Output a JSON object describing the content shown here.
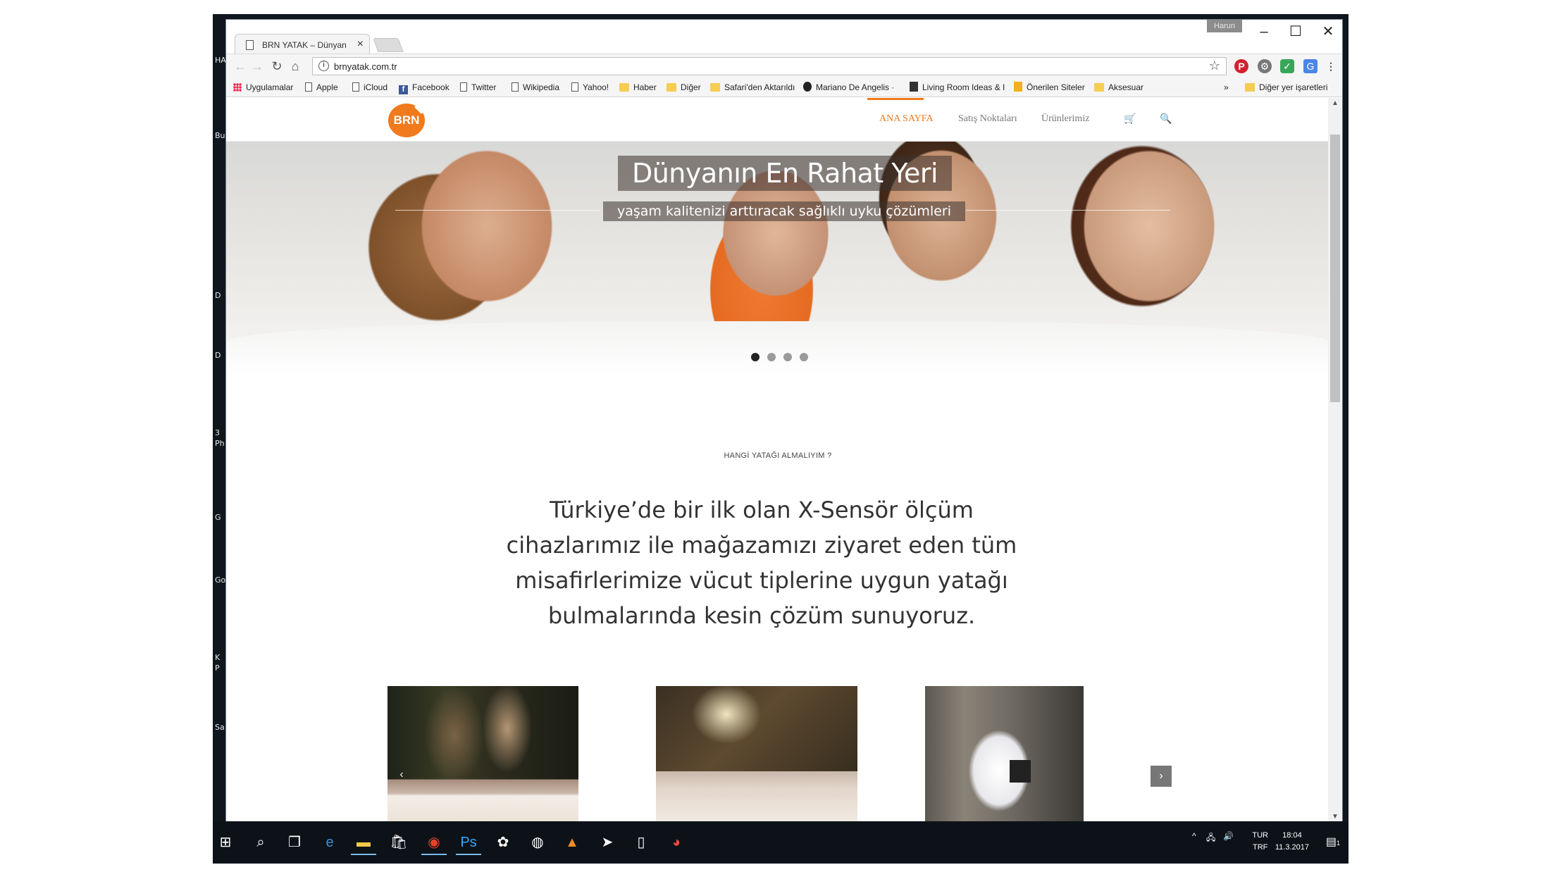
{
  "browser": {
    "tab_title": "BRN YATAK – Dünyanın E",
    "profile_name": "Harun",
    "url": "brnyatak.com.tr"
  },
  "bookmarks": {
    "items": [
      {
        "label": "Uygulamalar",
        "icon": "apps-icon"
      },
      {
        "label": "Apple",
        "icon": "page-icon"
      },
      {
        "label": "iCloud",
        "icon": "page-icon"
      },
      {
        "label": "Facebook",
        "icon": "facebook-icon"
      },
      {
        "label": "Twitter",
        "icon": "page-icon"
      },
      {
        "label": "Wikipedia",
        "icon": "page-icon"
      },
      {
        "label": "Yahoo!",
        "icon": "page-icon"
      },
      {
        "label": "Haber",
        "icon": "folder-icon"
      },
      {
        "label": "Diğer",
        "icon": "folder-icon"
      },
      {
        "label": "Safari'den Aktarıldı",
        "icon": "folder-icon"
      },
      {
        "label": "Mariano De Angelis ·",
        "icon": "site-icon"
      },
      {
        "label": "Living Room Ideas & I",
        "icon": "houzz-icon"
      },
      {
        "label": "Önerilen Siteler",
        "icon": "bing-icon"
      },
      {
        "label": "Aksesuar",
        "icon": "folder-icon"
      }
    ],
    "overflow": "»",
    "other": "Diğer yer işaretleri"
  },
  "site": {
    "logo_text": "BRN",
    "nav": {
      "home": "ANA SAYFA",
      "stores": "Satış Noktaları",
      "products": "Ürünlerimiz"
    }
  },
  "hero": {
    "title": "Dünyanın En Rahat Yeri",
    "subtitle": "yaşam kalitenizi arttıracak sağlıklı uyku çözümleri",
    "slides_total": 4,
    "active_slide": 1
  },
  "section": {
    "kicker": "HANGİ YATAĞI ALMALIYIM ?",
    "intro": "Türkiye’de bir ilk olan X-Sensör ölçüm cihazlarımız ile mağazamızı ziyaret eden tüm misafirlerimize vücut tiplerine uygun yatağı bulmalarında kesin çözüm sunuyoruz."
  },
  "carousel": {
    "prev": "‹",
    "next": "›"
  },
  "taskbar": {
    "lang_top": "TUR",
    "lang_bottom": "TRF",
    "time": "18:04",
    "date": "11.3.2017",
    "notification_count": "1"
  },
  "desktop": {
    "labels": [
      "HA",
      "Bu",
      "D",
      "D",
      "3",
      "Ph",
      "G",
      "Go",
      "K",
      "P",
      "Sa"
    ]
  }
}
